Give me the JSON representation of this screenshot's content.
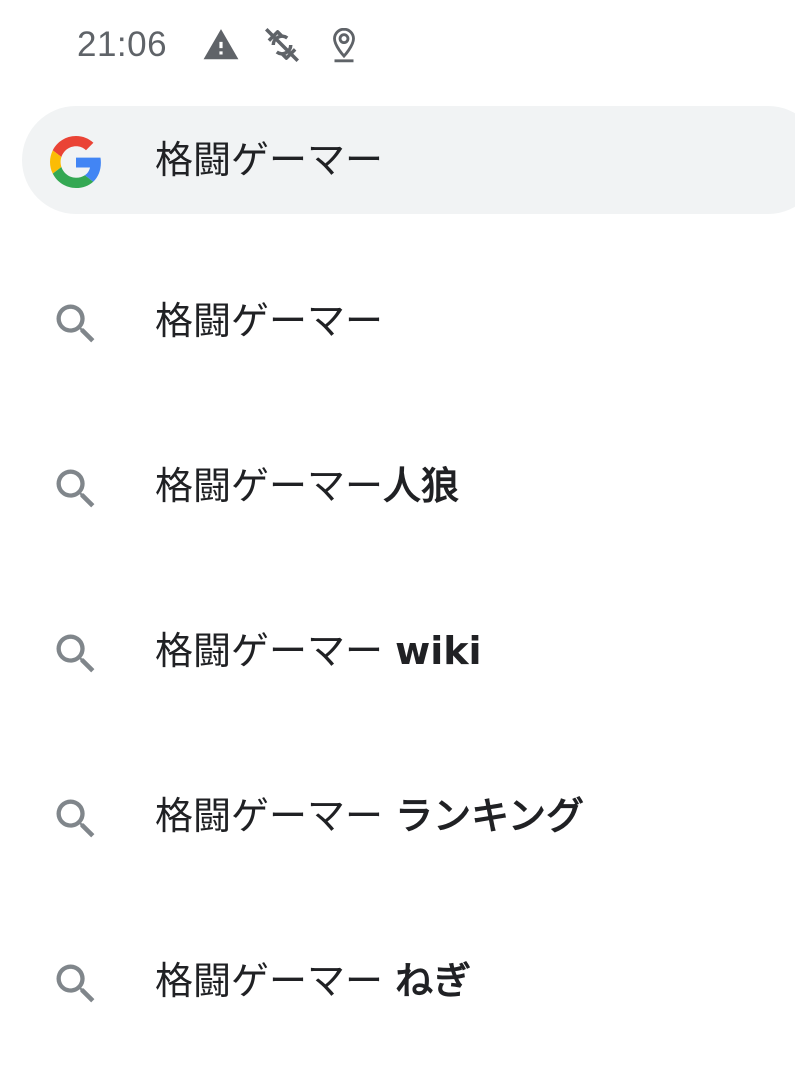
{
  "status_bar": {
    "time": "21:06",
    "icons": [
      "warning-icon",
      "sync-disabled-icon",
      "location-icon"
    ],
    "icon_color": "#5f6368"
  },
  "search": {
    "query": "格闘ゲーマー",
    "background": "#f1f3f4",
    "logo": "google-g-icon"
  },
  "suggestions": [
    {
      "base": "格闘ゲーマー",
      "completion": "",
      "icon": "search-icon"
    },
    {
      "base": "格闘ゲーマー",
      "completion": "人狼",
      "icon": "search-icon"
    },
    {
      "base": "格闘ゲーマー ",
      "completion": "wiki",
      "icon": "search-icon"
    },
    {
      "base": "格闘ゲーマー ",
      "completion": "ランキング",
      "icon": "search-icon"
    },
    {
      "base": "格闘ゲーマー ",
      "completion": "ねぎ",
      "icon": "search-icon"
    }
  ],
  "colors": {
    "text": "#202124",
    "icon_gray": "#80868b"
  }
}
